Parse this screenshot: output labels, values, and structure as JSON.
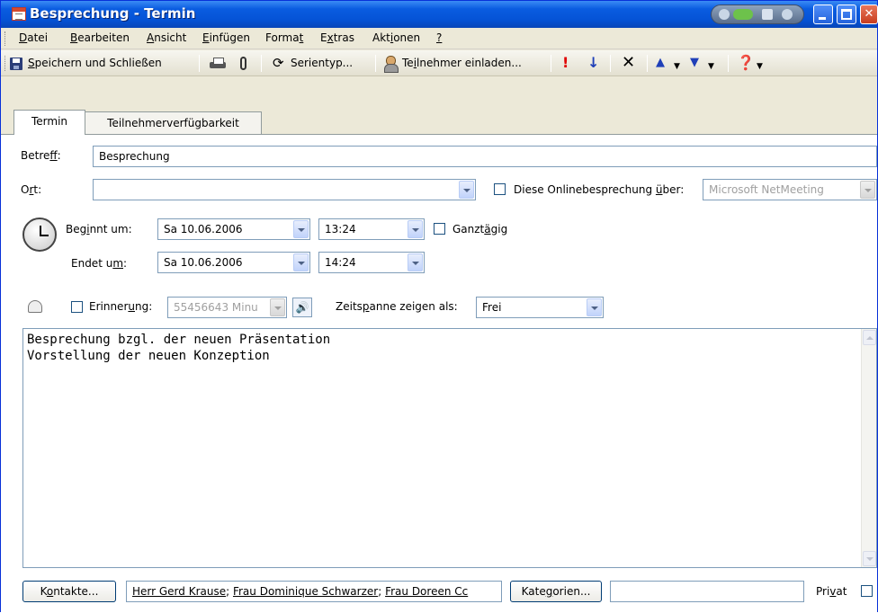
{
  "window": {
    "title": "Besprechung - Termin"
  },
  "menu": {
    "items": [
      {
        "pre": "",
        "key": "D",
        "post": "atei"
      },
      {
        "pre": "",
        "key": "B",
        "post": "earbeiten"
      },
      {
        "pre": "",
        "key": "A",
        "post": "nsicht"
      },
      {
        "pre": "",
        "key": "E",
        "post": "infügen"
      },
      {
        "pre": "Forma",
        "key": "t",
        "post": ""
      },
      {
        "pre": "E",
        "key": "x",
        "post": "tras"
      },
      {
        "pre": "Akt",
        "key": "i",
        "post": "onen"
      },
      {
        "pre": "",
        "key": "?",
        "post": ""
      }
    ]
  },
  "toolbar": {
    "save_key": "S",
    "save_rest": "peichern und Schließen",
    "recurrence_pre": "Serientyp",
    "recurrence_key": "",
    "recurrence_label": "Serientyp...",
    "invite_pre": "Te",
    "invite_key": "i",
    "invite_post": "lnehmer einladen...",
    "importance_high": "!",
    "importance_low": "↓",
    "delete": "✕"
  },
  "tabs": {
    "active": "Termin",
    "inactive": "Teilnehmerverfügbarkeit"
  },
  "form": {
    "subject_label_pre": "Betre",
    "subject_label_key": "f",
    "subject_label_post": "f:",
    "subject_value": "Besprechung",
    "location_label_pre": "O",
    "location_label_key": "r",
    "location_label_post": "t:",
    "location_value": "",
    "online_label_pre": "Diese Onlinebesprechung ",
    "online_label_key": "ü",
    "online_label_post": "ber:",
    "online_value": "Microsoft NetMeeting",
    "start_label_pre": "Beg",
    "start_label_key": "i",
    "start_label_post": "nnt um:",
    "start_date": "Sa 10.06.2006",
    "start_time": "13:24",
    "allday_pre": "Ganzt",
    "allday_key": "ä",
    "allday_post": "gig",
    "end_label_pre": "Endet u",
    "end_label_key": "m",
    "end_label_post": ":",
    "end_date": "Sa 10.06.2006",
    "end_time": "14:24",
    "reminder_pre": "Erinner",
    "reminder_key": "u",
    "reminder_post": "ng:",
    "reminder_value": "55456643 Minu",
    "showas_pre": "Zeits",
    "showas_key": "p",
    "showas_post": "anne zeigen als:",
    "showas_value": "Frei",
    "notes": "Besprechung bzgl. der neuen Präsentation\nVorstellung der neuen Konzeption"
  },
  "footer": {
    "contacts_button_pre": "K",
    "contacts_button_key": "o",
    "contacts_button_post": "ntakte...",
    "contacts": [
      "Herr Gerd Krause",
      "Frau Dominique Schwarzer",
      "Frau Doreen Cc"
    ],
    "categories_button_pre": "Kate",
    "categories_button_key": "g",
    "categories_button_post": "orien...",
    "categories_value": "",
    "private_pre": "Pri",
    "private_key": "v",
    "private_post": "at"
  }
}
